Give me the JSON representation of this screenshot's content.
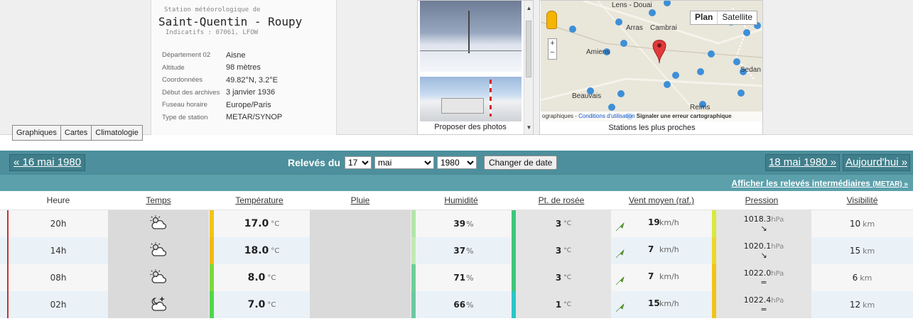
{
  "station": {
    "subtitle": "Station météorologique de",
    "name": "Saint-Quentin - Roupy",
    "indicatifs": "Indicatifs : 07061, LFOW",
    "details": [
      {
        "k": "Département 02",
        "v": "Aisne"
      },
      {
        "k": "Altitude",
        "v": "98 mètres"
      },
      {
        "k": "Coordonnées",
        "v": "49.82°N, 3.2°E"
      },
      {
        "k": "Début des archives",
        "v": "3 janvier 1936"
      },
      {
        "k": "Fuseau horaire",
        "v": "Europe/Paris"
      },
      {
        "k": "Type de station",
        "v": "METAR/SYNOP"
      }
    ]
  },
  "tabs": [
    "Graphiques",
    "Cartes",
    "Climatologie"
  ],
  "photos": {
    "caption": "Proposer des photos"
  },
  "map": {
    "caption": "Stations les plus proches",
    "type_plan": "Plan",
    "type_satellite": "Satellite",
    "labels": [
      "Lens - Douai",
      "Arras",
      "Cambrai",
      "Amiens",
      "Sedan",
      "Beauvais",
      "Reims"
    ],
    "attrib_left": "ographiques -",
    "attrib_link": "Conditions d'utilisation",
    "attrib_right": "Signaler une erreur cartographique"
  },
  "datebar": {
    "prev": "« 16 mai 1980",
    "label": "Relevés du",
    "day": "17",
    "month": "mai",
    "year": "1980",
    "button": "Changer de date",
    "next": "18 mai 1980 »",
    "today": "Aujourd'hui »"
  },
  "metar": {
    "text": "Afficher les relevés intermédiaires",
    "tag": "(METAR) »"
  },
  "headers": {
    "heure": "Heure",
    "temps": "Temps",
    "temperature": "Température",
    "pluie": "Pluie",
    "humidite": "Humidité",
    "rosee": "Pt. de rosée",
    "vent": "Vent moyen (raf.)",
    "pression": "Pression",
    "visibilite": "Visibilité"
  },
  "units": {
    "temp": "°C",
    "hum": "%",
    "wind": "km/h",
    "press": "hPa",
    "vis": "km"
  },
  "colors": {
    "accent": "#4d8f9c",
    "bar_light": "#5ba0ab",
    "row_marker": "#c93030"
  },
  "rows": [
    {
      "heure": "20h",
      "weather": "partly-cloudy-icon",
      "temp": "17.0",
      "temp_color": "#f2c418",
      "hum": "39",
      "hum_color": "#b2e6a8",
      "dew": "3",
      "dew_color": "#3ec67c",
      "wind": "19",
      "press": "1018.3",
      "press_trend": "↘",
      "press_color": "#d8ea3a",
      "vis": "10"
    },
    {
      "heure": "14h",
      "weather": "partly-cloudy-icon",
      "temp": "18.0",
      "temp_color": "#f2b918",
      "hum": "37",
      "hum_color": "#c2eab4",
      "dew": "3",
      "dew_color": "#3ec67c",
      "wind": "7",
      "press": "1020.1",
      "press_trend": "↘",
      "press_color": "#ecd82a",
      "vis": "15"
    },
    {
      "heure": "08h",
      "weather": "partly-cloudy-icon",
      "temp": "8.0",
      "temp_color": "#7cd93a",
      "hum": "71",
      "hum_color": "#6fcf98",
      "dew": "3",
      "dew_color": "#3ec67c",
      "wind": "7",
      "press": "1022.0",
      "press_trend": "=",
      "press_color": "#f2c418",
      "vis": "6"
    },
    {
      "heure": "02h",
      "weather": "night-cloudy-icon",
      "temp": "7.0",
      "temp_color": "#4fd64a",
      "hum": "66",
      "hum_color": "#6dc8a0",
      "dew": "1",
      "dew_color": "#29c6c6",
      "wind": "15",
      "press": "1022.4",
      "press_trend": "=",
      "press_color": "#f2c418",
      "vis": "12"
    }
  ]
}
